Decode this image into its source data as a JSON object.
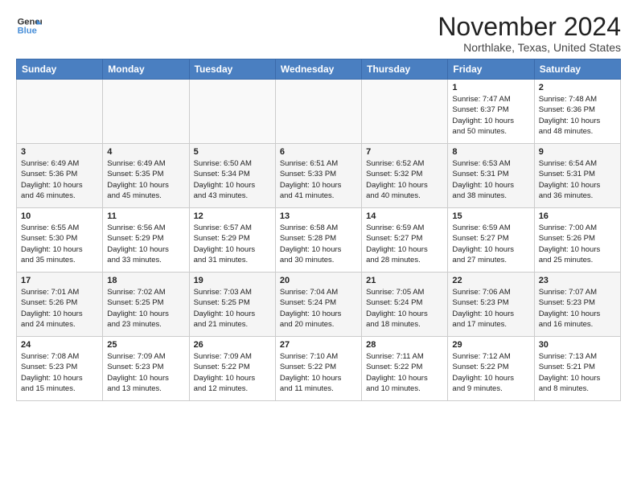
{
  "logo": {
    "line1": "General",
    "line2": "Blue"
  },
  "title": "November 2024",
  "location": "Northlake, Texas, United States",
  "days_of_week": [
    "Sunday",
    "Monday",
    "Tuesday",
    "Wednesday",
    "Thursday",
    "Friday",
    "Saturday"
  ],
  "weeks": [
    [
      {
        "day": "",
        "content": ""
      },
      {
        "day": "",
        "content": ""
      },
      {
        "day": "",
        "content": ""
      },
      {
        "day": "",
        "content": ""
      },
      {
        "day": "",
        "content": ""
      },
      {
        "day": "1",
        "content": "Sunrise: 7:47 AM\nSunset: 6:37 PM\nDaylight: 10 hours\nand 50 minutes."
      },
      {
        "day": "2",
        "content": "Sunrise: 7:48 AM\nSunset: 6:36 PM\nDaylight: 10 hours\nand 48 minutes."
      }
    ],
    [
      {
        "day": "3",
        "content": "Sunrise: 6:49 AM\nSunset: 5:36 PM\nDaylight: 10 hours\nand 46 minutes."
      },
      {
        "day": "4",
        "content": "Sunrise: 6:49 AM\nSunset: 5:35 PM\nDaylight: 10 hours\nand 45 minutes."
      },
      {
        "day": "5",
        "content": "Sunrise: 6:50 AM\nSunset: 5:34 PM\nDaylight: 10 hours\nand 43 minutes."
      },
      {
        "day": "6",
        "content": "Sunrise: 6:51 AM\nSunset: 5:33 PM\nDaylight: 10 hours\nand 41 minutes."
      },
      {
        "day": "7",
        "content": "Sunrise: 6:52 AM\nSunset: 5:32 PM\nDaylight: 10 hours\nand 40 minutes."
      },
      {
        "day": "8",
        "content": "Sunrise: 6:53 AM\nSunset: 5:31 PM\nDaylight: 10 hours\nand 38 minutes."
      },
      {
        "day": "9",
        "content": "Sunrise: 6:54 AM\nSunset: 5:31 PM\nDaylight: 10 hours\nand 36 minutes."
      }
    ],
    [
      {
        "day": "10",
        "content": "Sunrise: 6:55 AM\nSunset: 5:30 PM\nDaylight: 10 hours\nand 35 minutes."
      },
      {
        "day": "11",
        "content": "Sunrise: 6:56 AM\nSunset: 5:29 PM\nDaylight: 10 hours\nand 33 minutes."
      },
      {
        "day": "12",
        "content": "Sunrise: 6:57 AM\nSunset: 5:29 PM\nDaylight: 10 hours\nand 31 minutes."
      },
      {
        "day": "13",
        "content": "Sunrise: 6:58 AM\nSunset: 5:28 PM\nDaylight: 10 hours\nand 30 minutes."
      },
      {
        "day": "14",
        "content": "Sunrise: 6:59 AM\nSunset: 5:27 PM\nDaylight: 10 hours\nand 28 minutes."
      },
      {
        "day": "15",
        "content": "Sunrise: 6:59 AM\nSunset: 5:27 PM\nDaylight: 10 hours\nand 27 minutes."
      },
      {
        "day": "16",
        "content": "Sunrise: 7:00 AM\nSunset: 5:26 PM\nDaylight: 10 hours\nand 25 minutes."
      }
    ],
    [
      {
        "day": "17",
        "content": "Sunrise: 7:01 AM\nSunset: 5:26 PM\nDaylight: 10 hours\nand 24 minutes."
      },
      {
        "day": "18",
        "content": "Sunrise: 7:02 AM\nSunset: 5:25 PM\nDaylight: 10 hours\nand 23 minutes."
      },
      {
        "day": "19",
        "content": "Sunrise: 7:03 AM\nSunset: 5:25 PM\nDaylight: 10 hours\nand 21 minutes."
      },
      {
        "day": "20",
        "content": "Sunrise: 7:04 AM\nSunset: 5:24 PM\nDaylight: 10 hours\nand 20 minutes."
      },
      {
        "day": "21",
        "content": "Sunrise: 7:05 AM\nSunset: 5:24 PM\nDaylight: 10 hours\nand 18 minutes."
      },
      {
        "day": "22",
        "content": "Sunrise: 7:06 AM\nSunset: 5:23 PM\nDaylight: 10 hours\nand 17 minutes."
      },
      {
        "day": "23",
        "content": "Sunrise: 7:07 AM\nSunset: 5:23 PM\nDaylight: 10 hours\nand 16 minutes."
      }
    ],
    [
      {
        "day": "24",
        "content": "Sunrise: 7:08 AM\nSunset: 5:23 PM\nDaylight: 10 hours\nand 15 minutes."
      },
      {
        "day": "25",
        "content": "Sunrise: 7:09 AM\nSunset: 5:23 PM\nDaylight: 10 hours\nand 13 minutes."
      },
      {
        "day": "26",
        "content": "Sunrise: 7:09 AM\nSunset: 5:22 PM\nDaylight: 10 hours\nand 12 minutes."
      },
      {
        "day": "27",
        "content": "Sunrise: 7:10 AM\nSunset: 5:22 PM\nDaylight: 10 hours\nand 11 minutes."
      },
      {
        "day": "28",
        "content": "Sunrise: 7:11 AM\nSunset: 5:22 PM\nDaylight: 10 hours\nand 10 minutes."
      },
      {
        "day": "29",
        "content": "Sunrise: 7:12 AM\nSunset: 5:22 PM\nDaylight: 10 hours\nand 9 minutes."
      },
      {
        "day": "30",
        "content": "Sunrise: 7:13 AM\nSunset: 5:21 PM\nDaylight: 10 hours\nand 8 minutes."
      }
    ]
  ]
}
